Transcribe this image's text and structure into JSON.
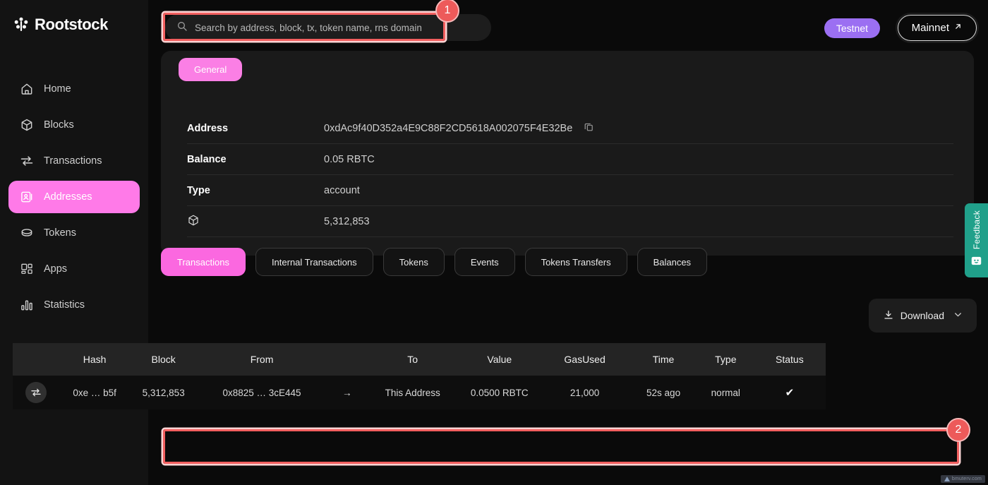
{
  "brand": {
    "name": "Rootstock",
    "logo_icon": "rootstock-logo-icon"
  },
  "search": {
    "placeholder": "Search by address, block, tx, token name, rns domain",
    "value": "",
    "icon": "search-icon"
  },
  "network": {
    "testnet_label": "Testnet",
    "mainnet_label": "Mainnet",
    "external_icon": "external-link-arrow-icon"
  },
  "sidebar": {
    "items": [
      {
        "label": "Home",
        "icon": "home-icon",
        "active": false
      },
      {
        "label": "Blocks",
        "icon": "cube-icon",
        "active": false
      },
      {
        "label": "Transactions",
        "icon": "transfer-arrows-icon",
        "active": false
      },
      {
        "label": "Addresses",
        "icon": "address-card-icon",
        "active": true
      },
      {
        "label": "Tokens",
        "icon": "coin-stack-icon",
        "active": false
      },
      {
        "label": "Apps",
        "icon": "apps-grid-icon",
        "active": false
      },
      {
        "label": "Statistics",
        "icon": "bar-chart-icon",
        "active": false
      }
    ]
  },
  "general_card": {
    "pill_label": "General",
    "rows": [
      {
        "key": "Address",
        "value": "0xdAc9f40D352a4E9C88F2CD5618A002075F4E32Be",
        "copy_icon": "copy-icon"
      },
      {
        "key": "Balance",
        "value": "0.05 RBTC"
      },
      {
        "key": "Type",
        "value": "account"
      },
      {
        "key": "",
        "key_icon": "cube-icon",
        "value": "5,312,853"
      }
    ]
  },
  "tabs": [
    {
      "label": "Transactions",
      "active": true
    },
    {
      "label": "Internal Transactions",
      "active": false
    },
    {
      "label": "Tokens",
      "active": false
    },
    {
      "label": "Events",
      "active": false
    },
    {
      "label": "Tokens Transfers",
      "active": false
    },
    {
      "label": "Balances",
      "active": false
    }
  ],
  "download": {
    "label": "Download",
    "icon": "download-icon",
    "chevron": "chevron-down-icon"
  },
  "table": {
    "columns": [
      "Hash",
      "Block",
      "From",
      "To",
      "Value",
      "GasUsed",
      "Time",
      "Type",
      "Status"
    ],
    "rows": [
      {
        "swap_icon": "transfer-arrows-icon",
        "hash": "0xe … b5f",
        "block": "5,312,853",
        "from": "0x8825 … 3cE445",
        "arrow": "→",
        "to": "This Address",
        "value": "0.0500 RBTC",
        "gas_used": "21,000",
        "time": "52s ago",
        "type": "normal",
        "status_icon": "check-icon",
        "status": "✔"
      }
    ]
  },
  "feedback": {
    "label": "Feedback",
    "icon": "smiley-face-icon"
  },
  "annotations": [
    {
      "number": "1"
    },
    {
      "number": "2"
    }
  ],
  "watermark": {
    "text": "bmuterv.com"
  },
  "colors": {
    "accent_pink": "#fb68e0",
    "accent_pink_light": "#ff7ae8",
    "testnet_purple": "#9b6ff2",
    "feedback_teal": "#20a08a",
    "annotation_red": "#ed5a5a",
    "background": "#0a0a0a",
    "card": "#1a1a1a"
  }
}
